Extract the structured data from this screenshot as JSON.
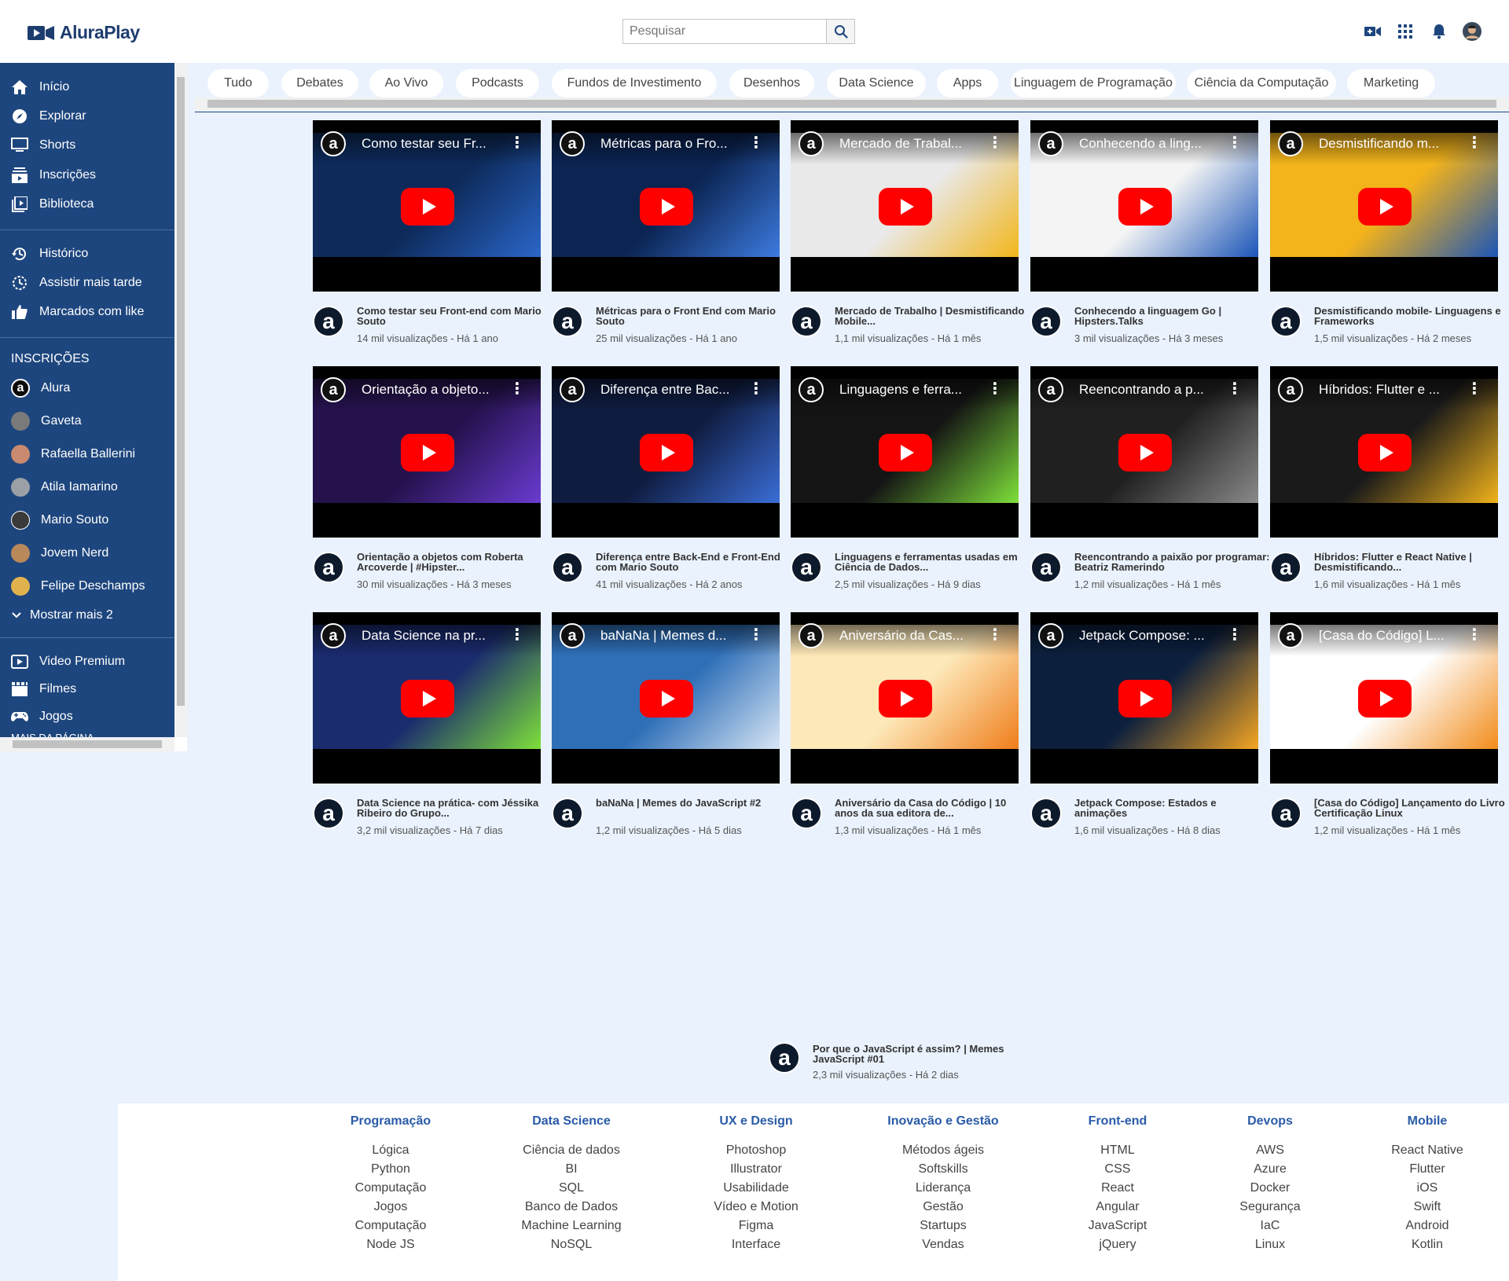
{
  "header": {
    "logo_text": "AluraPlay",
    "search_placeholder": "Pesquisar",
    "icons": [
      "camera-icon",
      "apps-grid-icon",
      "bell-icon",
      "user-avatar"
    ]
  },
  "sidebar": {
    "main": [
      {
        "label": "Início",
        "icon": "home-icon"
      },
      {
        "label": "Explorar",
        "icon": "compass-icon"
      },
      {
        "label": "Shorts",
        "icon": "monitor-icon"
      },
      {
        "label": "Inscrições",
        "icon": "subscriptions-icon"
      },
      {
        "label": "Biblioteca",
        "icon": "library-icon"
      }
    ],
    "personal": [
      {
        "label": "Histórico",
        "icon": "history-icon"
      },
      {
        "label": "Assistir mais tarde",
        "icon": "clock-icon"
      },
      {
        "label": "Marcados com like",
        "icon": "thumb-up-icon"
      }
    ],
    "subscriptions_heading": "INSCRIÇÕES",
    "subscriptions": [
      {
        "label": "Alura",
        "color": "#0b0b0b"
      },
      {
        "label": "Gaveta",
        "color": "#7a7a7a"
      },
      {
        "label": "Rafaella Ballerini",
        "color": "#c98a6f"
      },
      {
        "label": "Atila Iamarino",
        "color": "#9aa0a6"
      },
      {
        "label": "Mario Souto",
        "color": "#3a3a3a"
      },
      {
        "label": "Jovem Nerd",
        "color": "#b9895c"
      },
      {
        "label": "Felipe Deschamps",
        "color": "#e0b24d"
      }
    ],
    "show_more": "Mostrar mais 2",
    "extras": [
      {
        "label": "Video Premium",
        "icon": "premium-icon"
      },
      {
        "label": "Filmes",
        "icon": "film-icon"
      },
      {
        "label": "Jogos",
        "icon": "gamepad-icon"
      }
    ],
    "cut_label": "MAIS DA PÁGINA"
  },
  "chips": [
    "Tudo",
    "Debates",
    "Ao Vivo",
    "Podcasts",
    "Fundos de Investimento",
    "Desenhos",
    "Data Science",
    "Apps",
    "Linguagem de Programação",
    "Ciência da Computação",
    "Marketing"
  ],
  "videos": [
    {
      "thumb_title": "Como testar seu Fr...",
      "title": "Como testar seu Front-end com Mario Souto",
      "meta": "14 mil visualizações - Há 1 ano",
      "bg": "#0d2a5a",
      "accent": "#2b66c9"
    },
    {
      "thumb_title": "Métricas para o Fro...",
      "title": "Métricas para o Front End com Mario Souto",
      "meta": "25 mil visualizações - Há 1 ano",
      "bg": "#0b2452",
      "accent": "#3d7be0"
    },
    {
      "thumb_title": "Mercado de Trabal...",
      "title": "Mercado de Trabalho | Desmistificando Mobile...",
      "meta": "1,1 mil visualizações - Há 1 mês",
      "bg": "#e9e9e9",
      "accent": "#f2b61a"
    },
    {
      "thumb_title": "Conhecendo a ling...",
      "title": "Conhecendo a linguagem Go | Hipsters.Talks",
      "meta": "3 mil visualizações - Há 3 meses",
      "bg": "#f4f4f4",
      "accent": "#1b55b8"
    },
    {
      "thumb_title": "Desmistificando m...",
      "title": "Desmistificando mobile- Linguagens e Frameworks",
      "meta": "1,5 mil visualizações - Há 2 meses",
      "bg": "#f2b31b",
      "accent": "#1b55b8"
    },
    {
      "thumb_title": "Orientação a objeto...",
      "title": "Orientação a objetos com Roberta Arcoverde | #Hipster...",
      "meta": "30 mil visualizações - Há 3 meses",
      "bg": "#25124d",
      "accent": "#6a3bd1"
    },
    {
      "thumb_title": "Diferença entre Bac...",
      "title": "Diferença entre Back-End e Front-End com Mario Souto",
      "meta": "41 mil visualizações - Há 2 anos",
      "bg": "#0f1c40",
      "accent": "#3b6ed8"
    },
    {
      "thumb_title": "Linguagens e ferra...",
      "title": "Linguagens e ferramentas usadas em Ciência de Dados...",
      "meta": "2,5 mil visualizações - Há 9 dias",
      "bg": "#141414",
      "accent": "#7ee03a"
    },
    {
      "thumb_title": "Reencontrando a p...",
      "title": "Reencontrando a paixão por programar: Beatriz Ramerindo",
      "meta": "1,2 mil visualizações - Há 1 mês",
      "bg": "#202020",
      "accent": "#8a8a8a"
    },
    {
      "thumb_title": "Híbridos: Flutter e ...",
      "title": "Híbridos: Flutter e React Native | Desmistificando...",
      "meta": "1,6 mil visualizações - Há 1 mês",
      "bg": "#1a1a1a",
      "accent": "#f2b31b"
    },
    {
      "thumb_title": "Data Science na pr...",
      "title": "Data Science na prática- com Jéssika Ribeiro do Grupo...",
      "meta": "3,2 mil visualizações - Há 7 dias",
      "bg": "#1a2b6e",
      "accent": "#7ee03a"
    },
    {
      "thumb_title": "baNaNa | Memes d...",
      "title": "baNaNa | Memes do JavaScript #2",
      "meta": "1,2 mil visualizações - Há 5 dias",
      "bg": "#2f6fb8",
      "accent": "#d8e6f5"
    },
    {
      "thumb_title": "Aniversário da Cas...",
      "title": "Aniversário da Casa do Código | 10 anos da sua editora de...",
      "meta": "1,3 mil visualizações - Há 1 mês",
      "bg": "#fde8b8",
      "accent": "#ef7d1a"
    },
    {
      "thumb_title": "Jetpack Compose: ...",
      "title": "Jetpack Compose: Estados e animações",
      "meta": "1,6 mil visualizações - Há 8 dias",
      "bg": "#0c1f3d",
      "accent": "#f5a623"
    },
    {
      "thumb_title": "[Casa do Código] L...",
      "title": "[Casa do Código] Lançamento do Livro Certificação Linux",
      "meta": "1,2 mil visualizações - Há 1 mês",
      "bg": "#ffffff",
      "accent": "#f28c1a"
    }
  ],
  "orphan_video": {
    "title": "Por que o JavaScript é assim? | Memes JavaScript #01",
    "meta": "2,3 mil visualizações - Há 2 dias"
  },
  "footer": [
    {
      "heading": "Programação",
      "links": [
        "Lógica",
        "Python",
        "Computação",
        "Jogos",
        "Computação",
        "Node JS"
      ]
    },
    {
      "heading": "Data Science",
      "links": [
        "Ciência de dados",
        "BI",
        "SQL",
        "Banco de Dados",
        "Machine Learning",
        "NoSQL"
      ]
    },
    {
      "heading": "UX e Design",
      "links": [
        "Photoshop",
        "Illustrator",
        "Usabilidade",
        "Vídeo e Motion",
        "Figma",
        "Interface"
      ]
    },
    {
      "heading": "Inovação e Gestão",
      "links": [
        "Métodos ágeis",
        "Softskills",
        "Liderança",
        "Gestão",
        "Startups",
        "Vendas"
      ]
    },
    {
      "heading": "Front-end",
      "links": [
        "HTML",
        "CSS",
        "React",
        "Angular",
        "JavaScript",
        "jQuery"
      ]
    },
    {
      "heading": "Devops",
      "links": [
        "AWS",
        "Azure",
        "Docker",
        "Segurança",
        "IaC",
        "Linux"
      ]
    },
    {
      "heading": "Mobile",
      "links": [
        "React Native",
        "Flutter",
        "iOS",
        "Swift",
        "Android",
        "Kotlin"
      ]
    }
  ],
  "colors": {
    "sidebar": "#1e467e",
    "page_bg": "#eaf2fd",
    "accent": "#2a5ba8",
    "play": "#ff0000"
  }
}
